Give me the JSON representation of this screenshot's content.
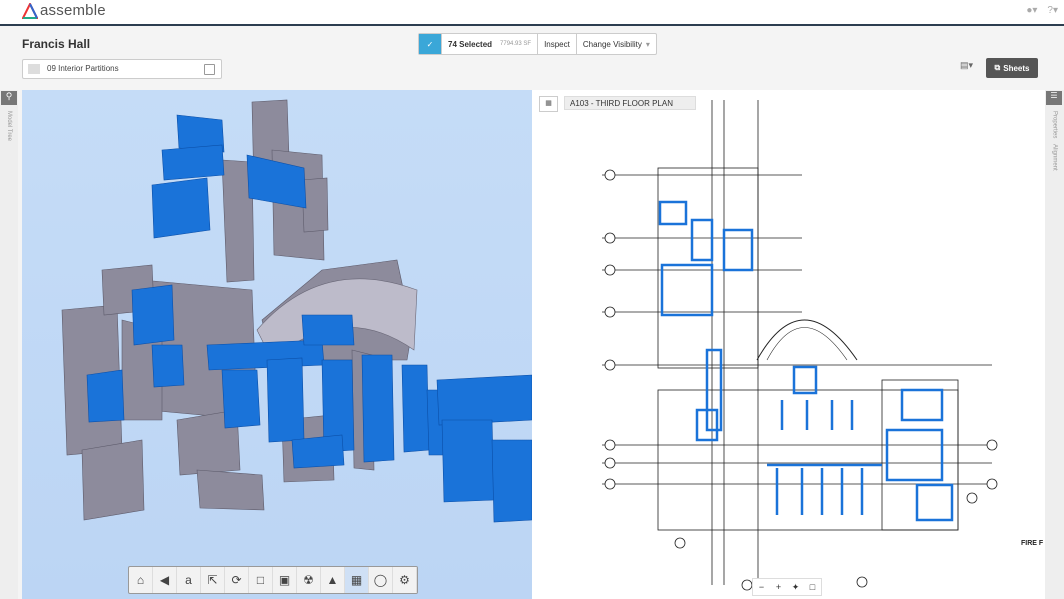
{
  "app": {
    "brand": "assemble"
  },
  "header": {
    "project_title": "Francis Hall"
  },
  "filter": {
    "value": "09 Interior Partitions"
  },
  "selection": {
    "count_label": "74 Selected",
    "area_label": "7794.93 SF",
    "inspect_label": "Inspect",
    "visibility_label": "Change Visibility"
  },
  "sheets_button": {
    "label": "Sheets"
  },
  "left_rail": {
    "model_tree_label": "Model Tree"
  },
  "right_rail": {
    "properties_label": "Properties",
    "alignment_label": "Alignment"
  },
  "sheet": {
    "name": "A103 - THIRD FLOOR PLAN",
    "fire_label": "FIRE F"
  },
  "toolbar": {
    "tools": [
      "home-icon",
      "first-person-icon",
      "measure-icon",
      "select-icon",
      "orbit-icon",
      "cube-icon",
      "section-box-icon",
      "explode-icon",
      "model-icon",
      "active-tool-icon",
      "camera-icon",
      "settings-icon"
    ]
  },
  "colors": {
    "accent": "#3aa7d8",
    "selected_wall": "#1a73d9",
    "wall": "#8c8a9b",
    "sky": "#c2daf6"
  }
}
